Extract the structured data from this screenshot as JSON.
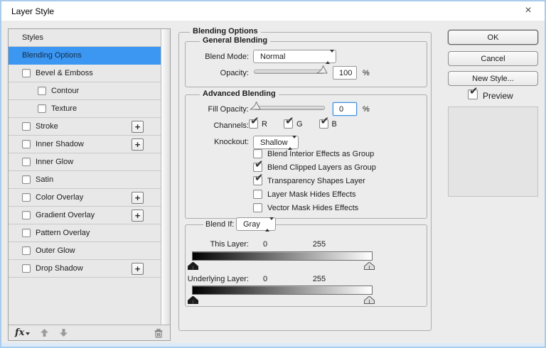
{
  "window": {
    "title": "Layer Style",
    "close_glyph": "×"
  },
  "sidebar": {
    "items": [
      {
        "label": "Styles",
        "type": "plain"
      },
      {
        "label": "Blending Options",
        "type": "plain",
        "selected": true
      },
      {
        "label": "Bevel & Emboss",
        "type": "check",
        "checked": false
      },
      {
        "label": "Contour",
        "type": "check",
        "checked": false,
        "indent": true
      },
      {
        "label": "Texture",
        "type": "check",
        "checked": false,
        "indent": true
      },
      {
        "label": "Stroke",
        "type": "check",
        "checked": false,
        "plus": true
      },
      {
        "label": "Inner Shadow",
        "type": "check",
        "checked": false,
        "plus": true
      },
      {
        "label": "Inner Glow",
        "type": "check",
        "checked": false
      },
      {
        "label": "Satin",
        "type": "check",
        "checked": false
      },
      {
        "label": "Color Overlay",
        "type": "check",
        "checked": false,
        "plus": true
      },
      {
        "label": "Gradient Overlay",
        "type": "check",
        "checked": false,
        "plus": true
      },
      {
        "label": "Pattern Overlay",
        "type": "check",
        "checked": false
      },
      {
        "label": "Outer Glow",
        "type": "check",
        "checked": false
      },
      {
        "label": "Drop Shadow",
        "type": "check",
        "checked": false,
        "plus": true
      }
    ],
    "footer": {
      "fx": "fx",
      "plus_glyph": "+"
    }
  },
  "panel": {
    "title": "Blending Options",
    "general": {
      "title": "General Blending",
      "blend_mode_label": "Blend Mode:",
      "blend_mode_value": "Normal",
      "opacity_label": "Opacity:",
      "opacity_value": "100",
      "percent": "%"
    },
    "advanced": {
      "title": "Advanced Blending",
      "fill_opacity_label": "Fill Opacity:",
      "fill_opacity_value": "0",
      "percent": "%",
      "channels_label": "Channels:",
      "channels": [
        {
          "label": "R",
          "checked": true
        },
        {
          "label": "G",
          "checked": true
        },
        {
          "label": "B",
          "checked": true
        }
      ],
      "knockout_label": "Knockout:",
      "knockout_value": "Shallow",
      "flags": [
        {
          "label": "Blend Interior Effects as Group",
          "checked": false
        },
        {
          "label": "Blend Clipped Layers as Group",
          "checked": true
        },
        {
          "label": "Transparency Shapes Layer",
          "checked": true
        },
        {
          "label": "Layer Mask Hides Effects",
          "checked": false
        },
        {
          "label": "Vector Mask Hides Effects",
          "checked": false
        }
      ]
    },
    "blend_if": {
      "label": "Blend If:",
      "value": "Gray",
      "this_layer_label": "This Layer:",
      "this_layer_min": "0",
      "this_layer_max": "255",
      "underlying_label": "Underlying Layer:",
      "underlying_min": "0",
      "underlying_max": "255"
    }
  },
  "actions": {
    "ok": "OK",
    "cancel": "Cancel",
    "new_style": "New Style...",
    "preview_label": "Preview",
    "preview_checked": true
  },
  "colors": {
    "selection_blue": "#3b97f2",
    "window_border": "#a9cbec"
  }
}
